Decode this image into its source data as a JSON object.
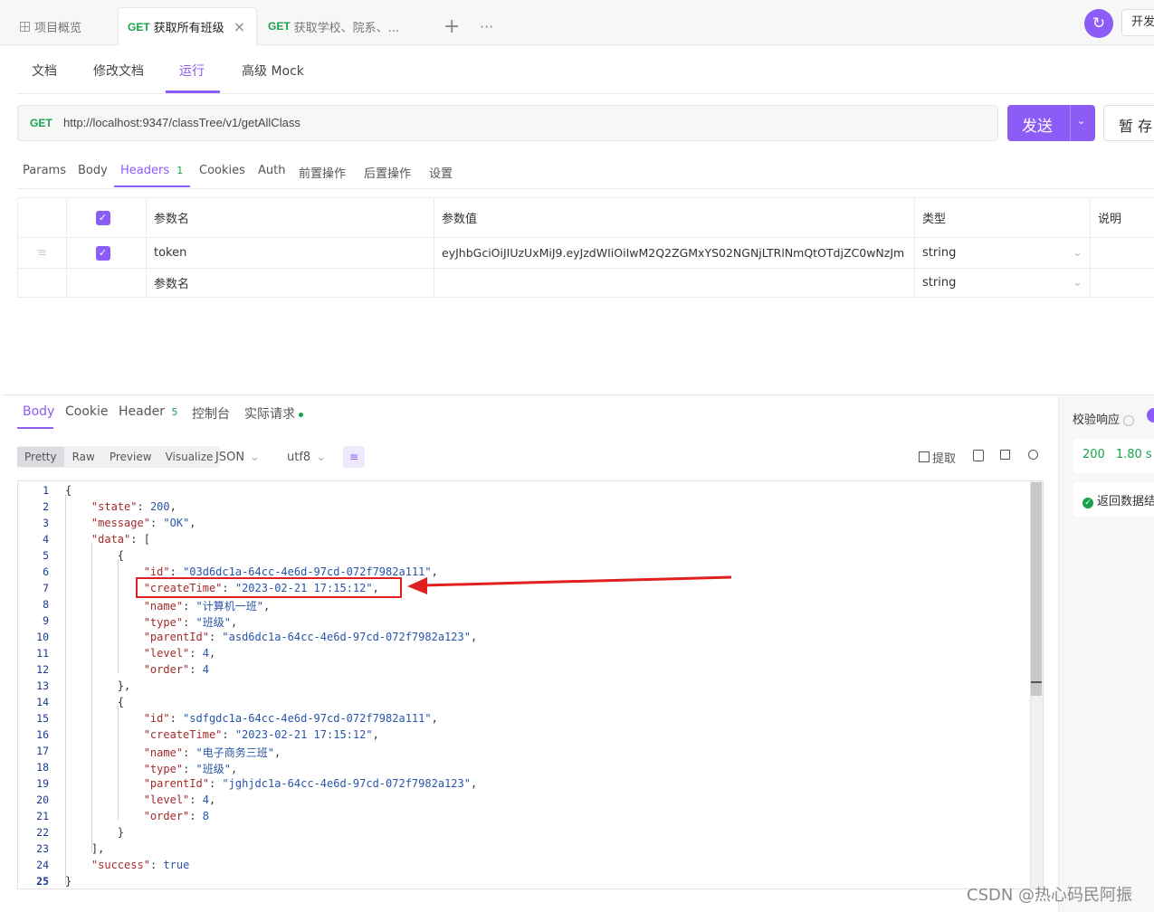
{
  "tabs": {
    "overview": "项目概览",
    "active_method": "GET",
    "active_title": "获取所有班级",
    "second_method": "GET",
    "second_title": "获取学校、院系、...",
    "right_button": "开发"
  },
  "nav": {
    "doc": "文档",
    "edit": "修改文档",
    "run": "运行",
    "mock": "高级 Mock"
  },
  "request": {
    "method": "GET",
    "url": "http://localhost:9347/classTree/v1/getAllClass",
    "send": "发送",
    "save": "暂 存"
  },
  "param_tabs": {
    "params": "Params",
    "body": "Body",
    "headers": "Headers",
    "headers_count": "1",
    "cookies": "Cookies",
    "auth": "Auth",
    "pre": "前置操作",
    "post": "后置操作",
    "settings": "设置"
  },
  "headers_table": {
    "col_name": "参数名",
    "col_value": "参数值",
    "col_type": "类型",
    "col_desc": "说明",
    "rows": [
      {
        "name": "token",
        "value": "eyJhbGciOiJIUzUxMiJ9.eyJzdWIiOiIwM2Q2ZGMxYS02NGNjLTRlNmQtOTdjZC0wNzJm",
        "type": "string"
      }
    ],
    "empty_name": "参数名",
    "empty_type": "string"
  },
  "response_tabs": {
    "body": "Body",
    "cookie": "Cookie",
    "header": "Header",
    "header_count": "5",
    "console": "控制台",
    "actual": "实际请求"
  },
  "format": {
    "pretty": "Pretty",
    "raw": "Raw",
    "preview": "Preview",
    "visualize": "Visualize",
    "json": "JSON",
    "encoding": "utf8",
    "extract": "提取"
  },
  "code_lines": [
    "{",
    "    \"state\": 200,",
    "    \"message\": \"OK\",",
    "    \"data\": [",
    "        {",
    "            \"id\": \"03d6dc1a-64cc-4e6d-97cd-072f7982a111\",",
    "            \"createTime\": \"2023-02-21 17:15:12\",",
    "            \"name\": \"计算机一班\",",
    "            \"type\": \"班级\",",
    "            \"parentId\": \"asd6dc1a-64cc-4e6d-97cd-072f7982a123\",",
    "            \"level\": 4,",
    "            \"order\": 4",
    "        },",
    "        {",
    "            \"id\": \"sdfgdc1a-64cc-4e6d-97cd-072f7982a111\",",
    "            \"createTime\": \"2023-02-21 17:15:12\",",
    "            \"name\": \"电子商务三班\",",
    "            \"type\": \"班级\",",
    "            \"parentId\": \"jghjdc1a-64cc-4e6d-97cd-072f7982a123\",",
    "            \"level\": 4,",
    "            \"order\": 8",
    "        }",
    "    ],",
    "    \"success\": true",
    "}"
  ],
  "side": {
    "validate": "校验响应",
    "status": "200",
    "time": "1.80 s",
    "returned": "返回数据结"
  },
  "watermark": "CSDN @热心码民阿振",
  "colors": {
    "accent": "#8b5cf6",
    "get": "#16a34a",
    "annotation": "#e02020"
  }
}
